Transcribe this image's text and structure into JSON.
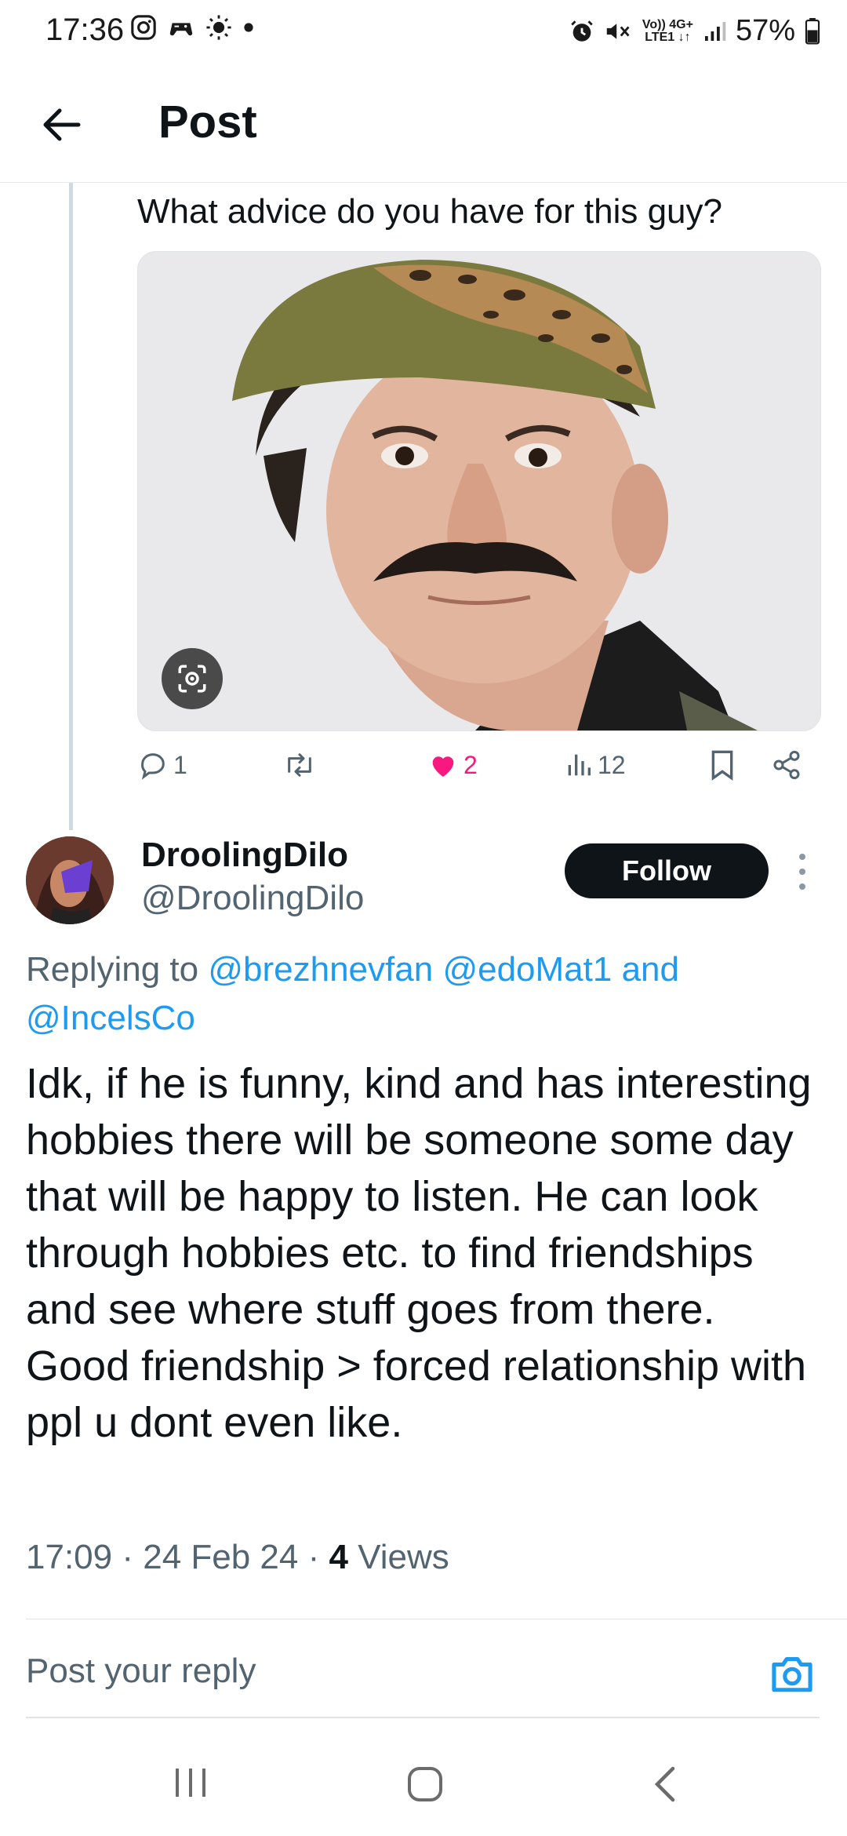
{
  "status_bar": {
    "time": "17:36",
    "battery_percent": "57%",
    "network_label_top": "Vo)) 4G+",
    "network_label_bottom": "LTE1 ↓↑"
  },
  "header": {
    "title": "Post"
  },
  "original_post": {
    "text": "What advice do you have for this guy?",
    "image_alt": "photo of man with cap and moustache",
    "replies": "1",
    "reposts": "",
    "likes": "2",
    "views": "12"
  },
  "reply": {
    "display_name": "DroolingDilo",
    "handle": "@DroolingDilo",
    "follow_label": "Follow",
    "replying_prefix": "Replying to ",
    "mention_1": "@brezhnevfan",
    "mention_2": "@edoMat1",
    "and_word": "and",
    "mention_3": "@IncelsCo",
    "body": "Idk, if he is funny, kind and has interesting hobbies there will be someone some day that will be happy to listen. He can look through hobbies etc. to find friendships and see where stuff goes from there. Good friendship > forced relationship with ppl u dont even like.",
    "time": "17:09",
    "date": "24 Feb 24",
    "views_count": "4",
    "views_label": "Views"
  },
  "composer": {
    "placeholder": "Post your reply"
  },
  "colors": {
    "accent": "#1d9bf0",
    "like": "#f91880",
    "text": "#0f1419",
    "secondary": "#536471"
  }
}
